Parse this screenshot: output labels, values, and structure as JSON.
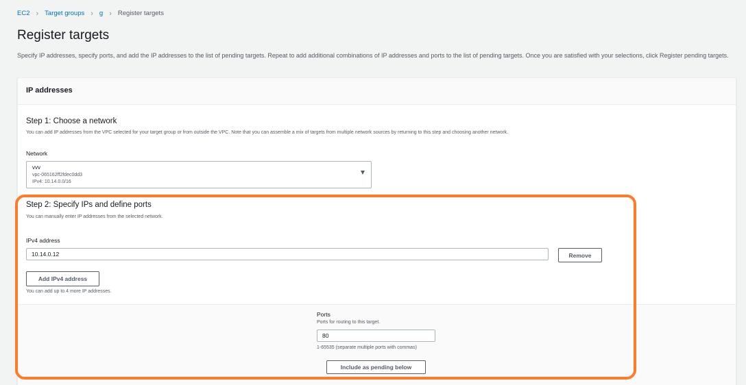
{
  "breadcrumb": {
    "items": [
      {
        "label": "EC2",
        "link": true
      },
      {
        "label": "Target groups",
        "link": true
      },
      {
        "label": "g",
        "link": true
      },
      {
        "label": "Register targets",
        "link": false
      }
    ]
  },
  "page": {
    "title": "Register targets",
    "description": "Specify IP addresses, specify ports, and add the IP addresses to the list of pending targets. Repeat to add additional combinations of IP addresses and ports to the list of pending targets. Once you are satisfied with your selections, click Register pending targets."
  },
  "panel": {
    "title": "IP addresses"
  },
  "step1": {
    "title": "Step 1: Choose a network",
    "description": "You can add IP addresses from the VPC selected for your target group or from outside the VPC. Note that you can assemble a mix of targets from multiple network sources by returning to this step and choosing another network.",
    "network_label": "Network",
    "network_selected": {
      "name": "vvv",
      "vpc_id": "vpc-065162ff2fdec0dd3",
      "cidr": "IPv4: 10.14.0.0/16"
    }
  },
  "step2": {
    "title": "Step 2: Specify IPs and define ports",
    "description": "You can manually enter IP addresses from the selected network.",
    "ipv4_label": "IPv4 address",
    "ipv4_value": "10.14.0.12",
    "remove_label": "Remove",
    "add_ipv4_label": "Add IPv4 address",
    "add_hint": "You can add up to 4 more IP addresses."
  },
  "ports": {
    "label": "Ports",
    "description": "Ports for routing to this target.",
    "value": "80",
    "hint": "1-65535 (separate multiple ports with commas)",
    "include_label": "Include as pending below"
  },
  "colors": {
    "highlight": "#ff7b26",
    "link": "#0073bb",
    "background": "#f2f3f3"
  }
}
